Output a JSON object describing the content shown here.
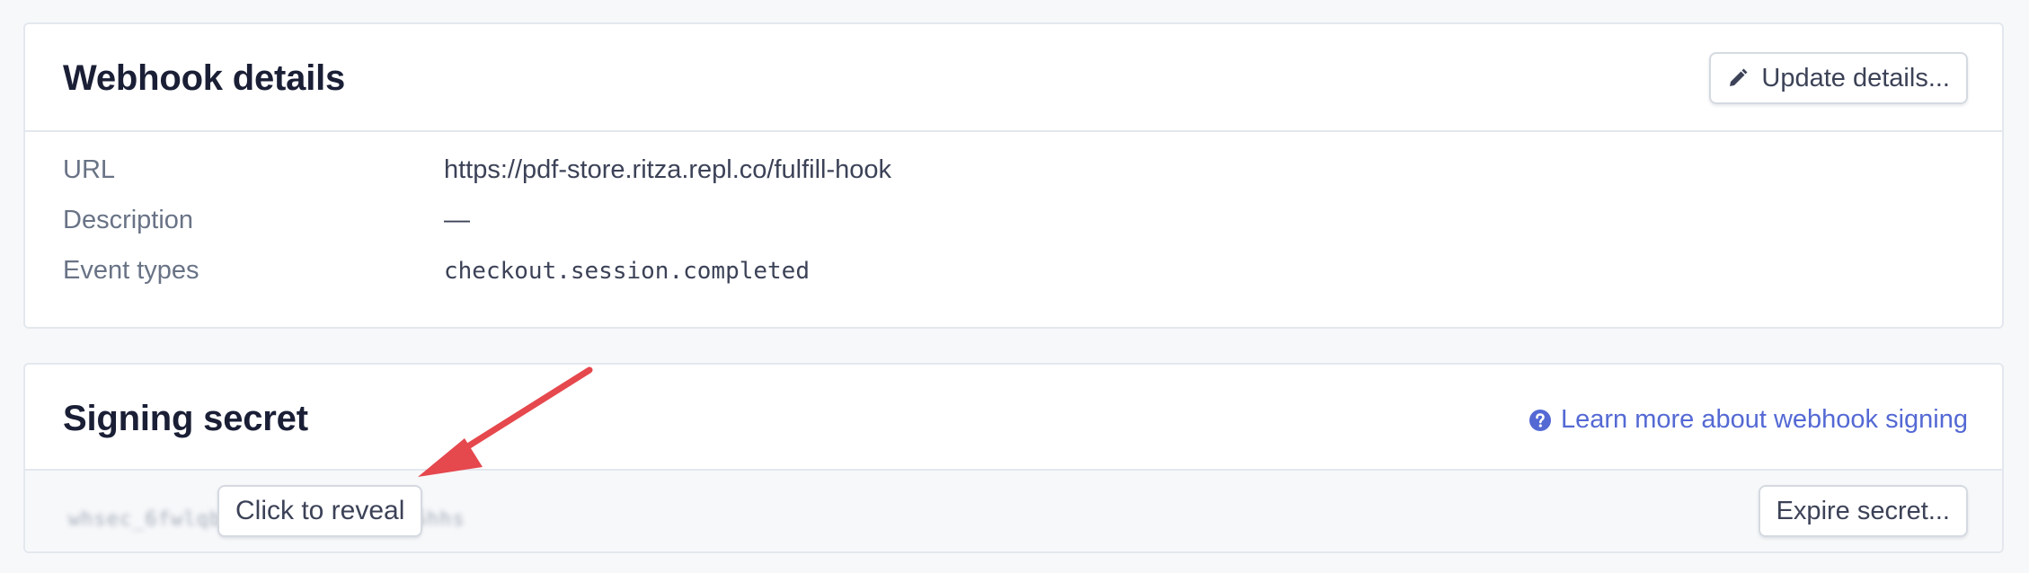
{
  "webhook_details": {
    "title": "Webhook details",
    "update_button_label": "Update details...",
    "rows": [
      {
        "label": "URL",
        "value": "https://pdf-store.ritza.repl.co/fulfill-hook"
      },
      {
        "label": "Description",
        "value": "—"
      },
      {
        "label": "Event types",
        "value": "checkout.session.completed"
      }
    ]
  },
  "signing_secret": {
    "title": "Signing secret",
    "learn_more_label": "Learn more about webhook signing",
    "masked_secret": "whsec_6fwlqb8a1f0cd51390a3b6hhs",
    "reveal_button_label": "Click to reveal",
    "expire_button_label": "Expire secret..."
  },
  "colors": {
    "link": "#5469d4",
    "annotation_arrow": "#e5484d",
    "title_text": "#1a1f36",
    "label_text": "#697386"
  },
  "icons": {
    "update_button": "pencil-icon",
    "learn_more_link": "question-circle-icon",
    "annotation": "red-arrow-icon"
  }
}
